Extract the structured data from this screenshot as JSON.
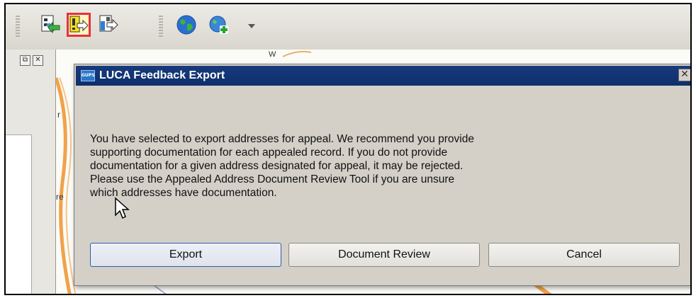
{
  "toolbar": {
    "buttons": [
      {
        "icon": "import-icon"
      },
      {
        "icon": "export-icon",
        "highlighted": true
      },
      {
        "icon": "document-review-icon"
      },
      {
        "icon": "globe-icon"
      },
      {
        "icon": "add-layer-icon"
      },
      {
        "icon": "chevron-down-icon"
      }
    ]
  },
  "map_labels": [
    "W",
    "r",
    "re"
  ],
  "dialog": {
    "logo_text": "GUPS",
    "title": "LUCA Feedback Export",
    "close_glyph": "✕",
    "message": "You have selected to export addresses for appeal. We recommend you provide\nsupporting documentation for each appealed record. If you do not provide\ndocumentation for a given address designated for appeal, it may be rejected.\nPlease use the Appealed Address Document Review Tool if you are unsure\nwhich addresses have documentation.",
    "buttons": {
      "export": "Export",
      "document_review": "Document Review",
      "cancel": "Cancel"
    }
  },
  "colors": {
    "titlebar": "#0f2f6b",
    "highlight_border": "#e8303a",
    "map_road": "#f0a24a"
  }
}
